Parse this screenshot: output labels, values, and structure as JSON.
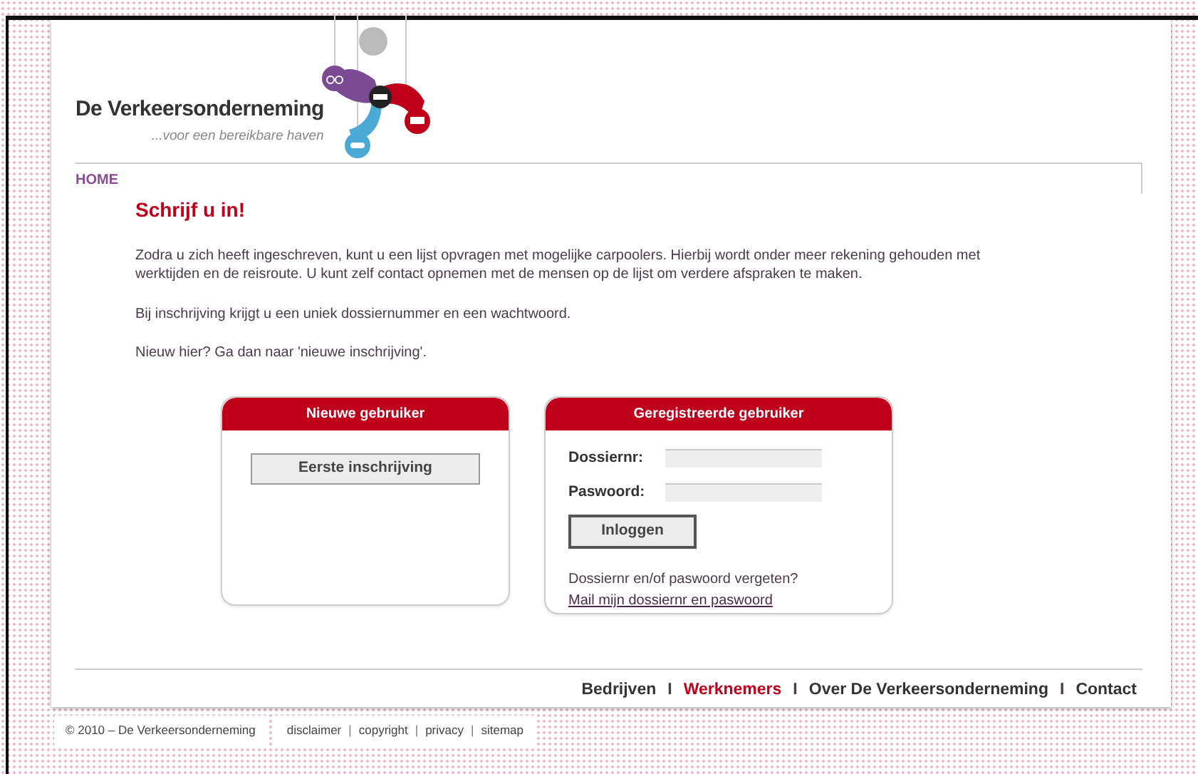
{
  "logo": {
    "name": "De Verkeersonderneming",
    "tagline": "...voor een bereikbare haven"
  },
  "breadcrumb": {
    "label": "HOME"
  },
  "content": {
    "heading": "Schrijf u in!",
    "paragraphs": [
      "Zodra u zich heeft ingeschreven, kunt u een lijst opvragen met mogelijke carpoolers. Hierbij wordt onder meer rekening gehouden met werktijden en de reisroute. U kunt zelf contact opnemen met de mensen op de lijst om verdere afspraken te maken.",
      "Bij inschrijving krijgt u een uniek dossiernummer en een wachtwoord.",
      "Nieuw hier? Ga dan naar 'nieuwe inschrijving'."
    ]
  },
  "new_user_panel": {
    "title": "Nieuwe gebruiker",
    "button": "Eerste inschrijving"
  },
  "registered_panel": {
    "title": "Geregistreerde gebruiker",
    "fields": [
      {
        "label": "Dossiernr:"
      },
      {
        "label": "Paswoord:"
      }
    ],
    "button": "Inloggen",
    "forgot_text": "Dossiernr en/of paswoord vergeten?",
    "mail_link": "Mail mijn dossiernr en paswoord"
  },
  "footer_nav": [
    {
      "kind": "link",
      "label": "Bedrijven",
      "selected": false
    },
    {
      "kind": "separator",
      "label": "I"
    },
    {
      "kind": "link",
      "label": "Werknemers",
      "selected": true
    },
    {
      "kind": "separator",
      "label": "I"
    },
    {
      "kind": "link",
      "label": "Over De Verkeersonderneming",
      "selected": false
    },
    {
      "kind": "separator",
      "label": "I"
    },
    {
      "kind": "link",
      "label": "Contact",
      "selected": false
    }
  ],
  "bottom_bar": {
    "copyright": "© 2010 – De Verkeersonderneming",
    "links": [
      {
        "kind": "link",
        "label": "disclaimer"
      },
      {
        "kind": "separator",
        "label": "|"
      },
      {
        "kind": "link",
        "label": "copyright"
      },
      {
        "kind": "separator",
        "label": "|"
      },
      {
        "kind": "link",
        "label": "privacy"
      },
      {
        "kind": "separator",
        "label": "|"
      },
      {
        "kind": "link",
        "label": "sitemap"
      }
    ]
  }
}
